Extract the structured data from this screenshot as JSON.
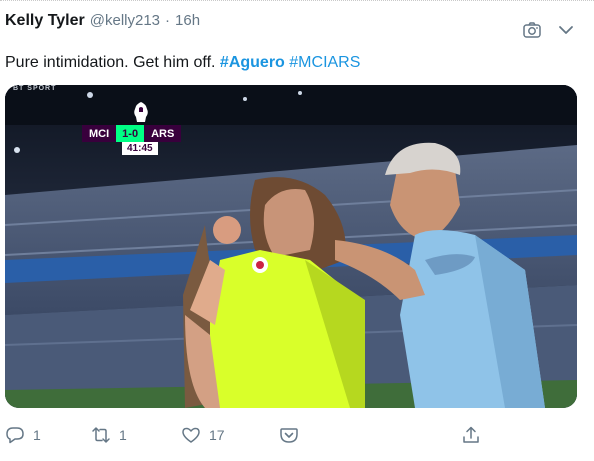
{
  "tweet": {
    "display_name": "Kelly Tyler",
    "handle": "@kelly213",
    "separator": "·",
    "time": "16h",
    "text_plain": "Pure intimidation. Get him off. ",
    "hashtags": [
      "#Aguero",
      "#MCIARS"
    ]
  },
  "header_icons": [
    "camera-icon",
    "chevron-down-icon"
  ],
  "media": {
    "broadcaster": "BT SPORT",
    "scorebug": {
      "home": "MCI",
      "score": "1-0",
      "away": "ARS",
      "clock": "41:45"
    }
  },
  "actions": {
    "reply_count": "1",
    "retweet_count": "1",
    "like_count": "17",
    "icons": [
      "reply-icon",
      "retweet-icon",
      "like-icon",
      "pocket-icon",
      "share-icon"
    ]
  },
  "colors": {
    "link": "#1b95e0",
    "muted": "#657786",
    "text": "#14171a",
    "pl_purple": "#38003c",
    "pl_green": "#00ff85"
  }
}
